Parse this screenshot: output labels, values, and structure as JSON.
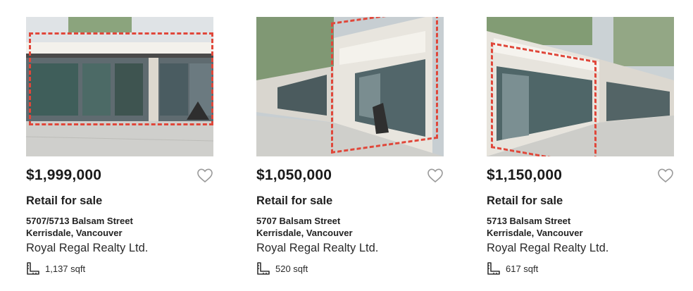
{
  "listings": [
    {
      "price": "$1,999,000",
      "type": "Retail for sale",
      "address_line1": "5707/5713 Balsam Street",
      "address_line2": "Kerrisdale, Vancouver",
      "brokerage": "Royal Regal Realty Ltd.",
      "size": "1,137 sqft",
      "photo_alt": "Storefront with red dashed outline around two retail units",
      "favorite": false
    },
    {
      "price": "$1,050,000",
      "type": "Retail for sale",
      "address_line1": "5707 Balsam Street",
      "address_line2": "Kerrisdale, Vancouver",
      "brokerage": "Royal Regal Realty Ltd.",
      "size": "520 sqft",
      "photo_alt": "Angled storefront view with red dashed outline",
      "favorite": false
    },
    {
      "price": "$1,150,000",
      "type": "Retail for sale",
      "address_line1": "5713 Balsam Street",
      "address_line2": "Kerrisdale, Vancouver",
      "brokerage": "Royal Regal Realty Ltd.",
      "size": "617 sqft",
      "photo_alt": "Corner storefront view with red dashed outline",
      "favorite": false
    }
  ],
  "icons": {
    "favorite": "heart-outline-icon",
    "size": "ruler-icon"
  },
  "colors": {
    "outline": "#e0473a",
    "heart": "#9a9a9a",
    "text": "#1c1c1c"
  }
}
